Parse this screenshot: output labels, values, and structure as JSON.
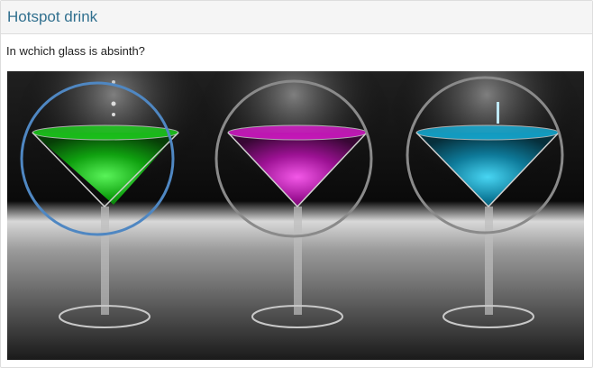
{
  "panel": {
    "title": "Hotspot drink",
    "question": "In wchich glass is absinth?"
  },
  "hotspots": [
    {
      "name": "hotspot-green-glass",
      "color": "#4f87c2",
      "drink_color": "#1fd81f",
      "selected": true
    },
    {
      "name": "hotspot-magenta-glass",
      "color": "#8a8a8a",
      "drink_color": "#e01bd2",
      "selected": false
    },
    {
      "name": "hotspot-blue-glass",
      "color": "#8a8a8a",
      "drink_color": "#16b5e0",
      "selected": false
    }
  ],
  "colors": {
    "heading_text": "#31708f",
    "selected_ring": "#4f87c2",
    "unselected_ring": "#8a8a8a"
  }
}
